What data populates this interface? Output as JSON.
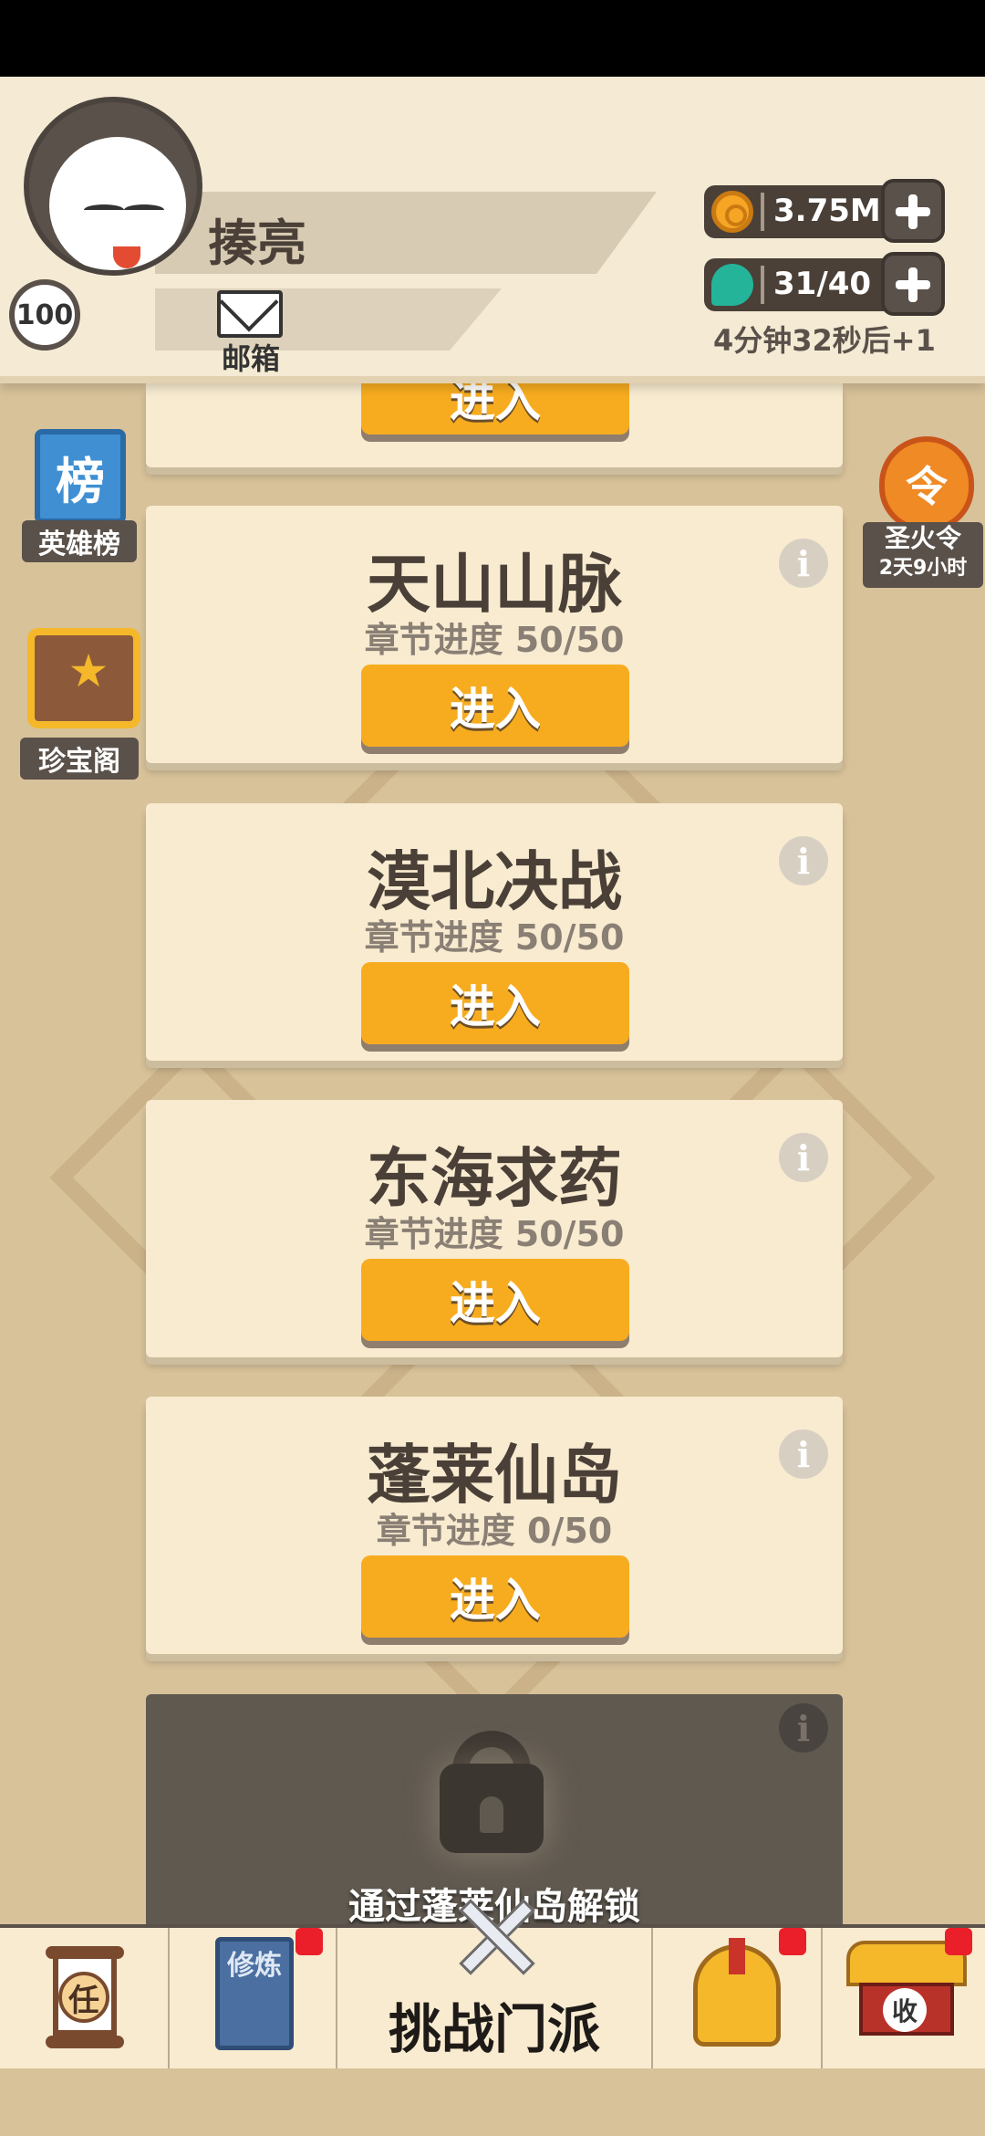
{
  "player": {
    "name": "揍亮",
    "level": "100",
    "mail_label": "邮箱"
  },
  "resources": {
    "coins": "3.75M",
    "energy": "31/40",
    "energy_timer": "4分钟32秒后+1"
  },
  "side_left": {
    "ranking_icon_char": "榜",
    "ranking_label": "英雄榜",
    "treasure_label": "珍宝阁"
  },
  "side_right": {
    "holyfire_icon_char": "令",
    "holyfire_label": "圣火令",
    "holyfire_timer": "2天9小时"
  },
  "chapters": [
    {
      "title": "",
      "progress": "",
      "button": "进入"
    },
    {
      "title": "天山山脉",
      "progress": "章节进度 50/50",
      "button": "进入"
    },
    {
      "title": "漠北决战",
      "progress": "章节进度 50/50",
      "button": "进入"
    },
    {
      "title": "东海求药",
      "progress": "章节进度 50/50",
      "button": "进入"
    },
    {
      "title": "蓬莱仙岛",
      "progress": "章节进度 0/50",
      "button": "进入"
    }
  ],
  "locked": {
    "unlock_text": "通过蓬莱仙岛解锁"
  },
  "info_glyph": "i",
  "bottom_nav": {
    "task_char": "任",
    "cultivate_chars": "修炼",
    "challenge_label": "挑战门派",
    "collect_char": "收"
  },
  "colors": {
    "button": "#f7ac1f",
    "card": "#f8ebd0",
    "background": "#d8c29a",
    "badge_red": "#ea1f2a"
  }
}
